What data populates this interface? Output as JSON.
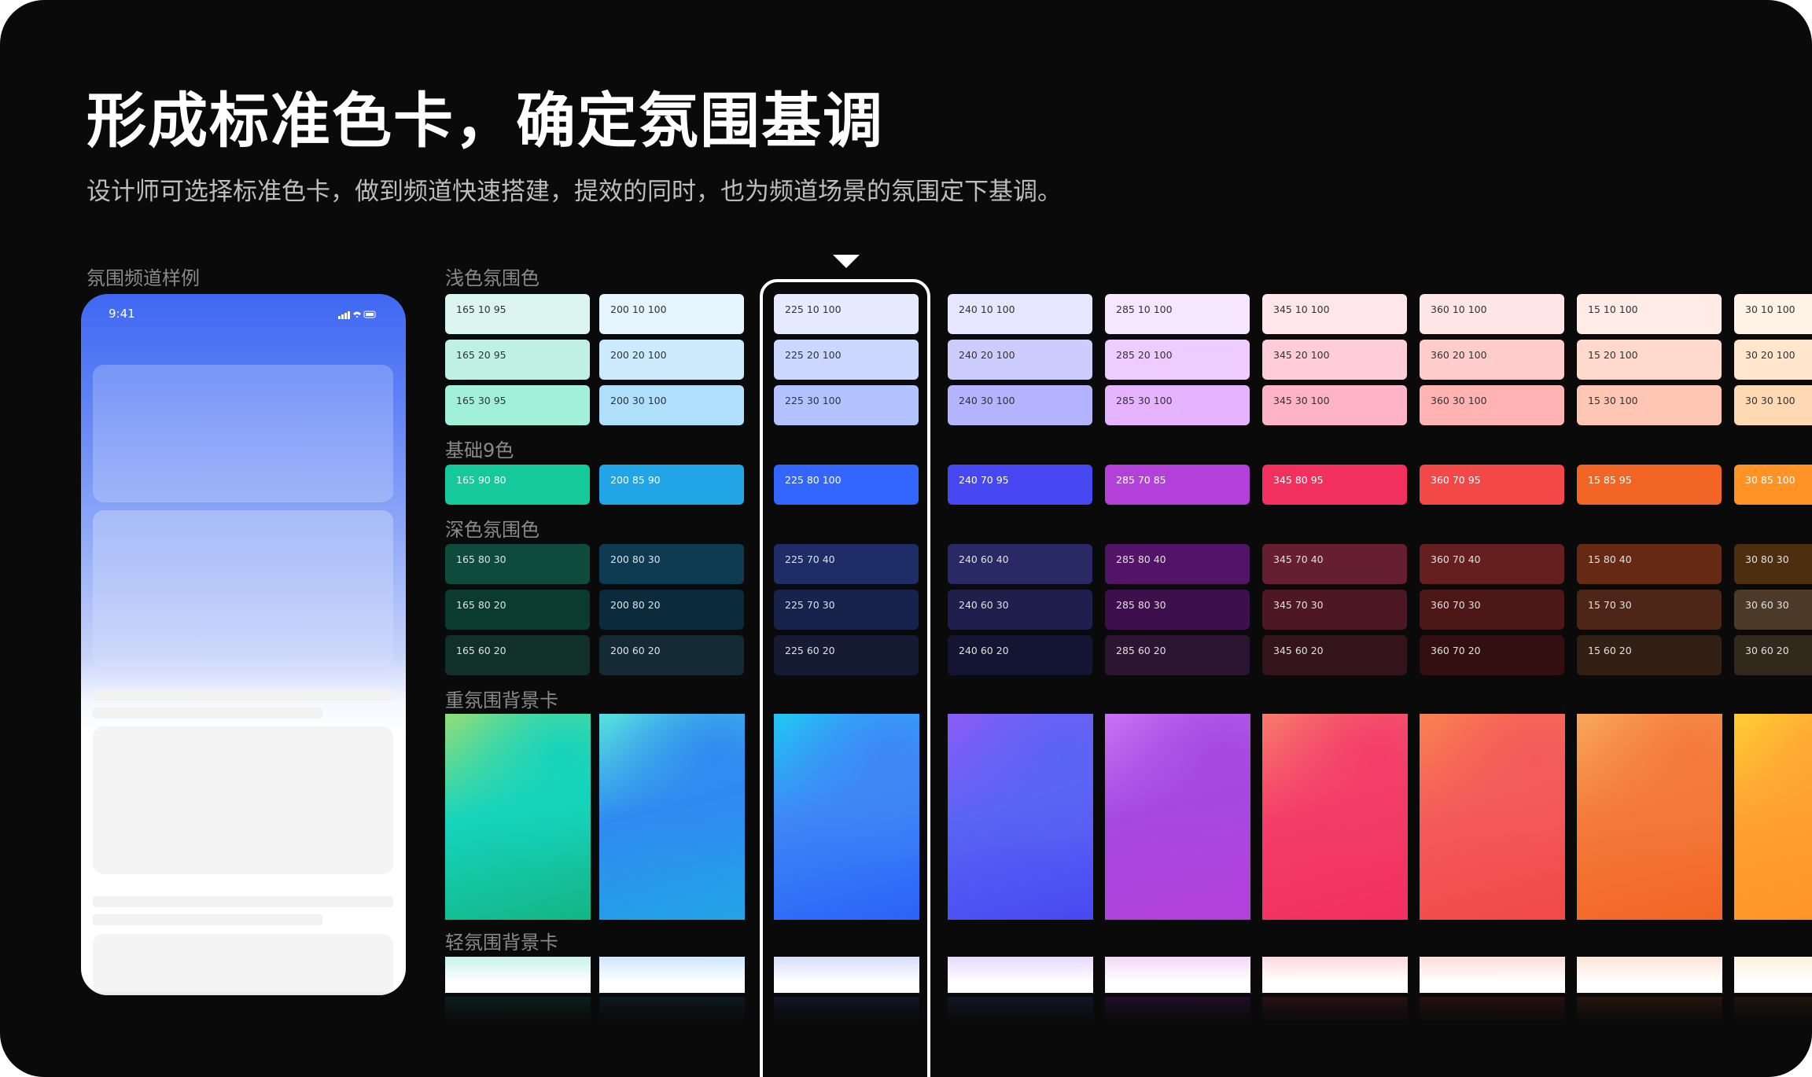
{
  "title": "形成标准色卡，确定氛围基调",
  "subtitle": "设计师可选择标准色卡，做到频道快速搭建，提效的同时，也为频道场景的氛围定下基调。",
  "sections": {
    "sample": "氛围频道样例",
    "light": "浅色氛围色",
    "base": "基础9色",
    "dark": "深色氛围色",
    "heavy_bg": "重氛围背景卡",
    "light_bg": "轻氛围背景卡"
  },
  "phone": {
    "time": "9:41"
  },
  "columns": [
    {
      "light": [
        "165 10 95",
        "165 20 95",
        "165 30 95"
      ],
      "base": "165 90 80",
      "dark": [
        "165 80 30",
        "165 80 20",
        "165 60 20"
      ],
      "light_colors": [
        "#dcf5ee",
        "#bff0e2",
        "#a3f0d9"
      ],
      "base_color": "#15c99a",
      "dark_colors": [
        "#0e4b3c",
        "#0b3a2f",
        "#12302a"
      ],
      "heavy": [
        "#8fdc7a",
        "#16d4bd",
        "#13b585"
      ],
      "tint": "#c8f2ea"
    },
    {
      "light": [
        "200 10 100",
        "200 20 100",
        "200 30 100"
      ],
      "base": "200 85 90",
      "dark": [
        "200 80 30",
        "200 80 20",
        "200 60 20"
      ],
      "light_colors": [
        "#e6f4fd",
        "#cdeafd",
        "#b0dffc"
      ],
      "base_color": "#22a5e6",
      "dark_colors": [
        "#0f3b52",
        "#0b2a3b",
        "#142a35"
      ],
      "heavy": [
        "#56e0e0",
        "#2f8af0",
        "#22a5e6"
      ],
      "tint": "#cfe6ff"
    },
    {
      "light": [
        "225 10 100",
        "225 20 100",
        "225 30 100"
      ],
      "base": "225 80 100",
      "dark": [
        "225 70 40",
        "225 70 30",
        "225 60 20"
      ],
      "light_colors": [
        "#e6ebff",
        "#ccd7ff",
        "#b3c3ff"
      ],
      "base_color": "#3366ff",
      "dark_colors": [
        "#1f2d66",
        "#17224d",
        "#141b33"
      ],
      "heavy": [
        "#22c6f4",
        "#3f86f6",
        "#2a63f8"
      ],
      "tint": "#d8dcff"
    },
    {
      "light": [
        "240 10 100",
        "240 20 100",
        "240 30 100"
      ],
      "base": "240 70 95",
      "dark": [
        "240 60 40",
        "240 60 30",
        "240 60 20"
      ],
      "light_colors": [
        "#e6e6ff",
        "#ccccff",
        "#b3b3ff"
      ],
      "base_color": "#4848f2",
      "dark_colors": [
        "#292966",
        "#1f1f4d",
        "#141433"
      ],
      "heavy": [
        "#8a5cf6",
        "#5a64f4",
        "#4848f2"
      ],
      "tint": "#e6d8ff"
    },
    {
      "light": [
        "285 10 100",
        "285 20 100",
        "285 30 100"
      ],
      "base": "285 70 85",
      "dark": [
        "285 80 40",
        "285 80 30",
        "285 60 20"
      ],
      "light_colors": [
        "#f7e6ff",
        "#efccff",
        "#e6b3ff"
      ],
      "base_color": "#b340d9",
      "dark_colors": [
        "#521466",
        "#3d0f4d",
        "#2c1433"
      ],
      "heavy": [
        "#c970f5",
        "#a648e0",
        "#b340d9"
      ],
      "tint": "#f4d8f8"
    },
    {
      "light": [
        "345 10 100",
        "345 20 100",
        "345 30 100"
      ],
      "base": "345 80 95",
      "dark": [
        "345 70 40",
        "345 70 30",
        "345 60 20"
      ],
      "light_colors": [
        "#ffe6ec",
        "#ffccd9",
        "#ffb3c6"
      ],
      "base_color": "#f2305f",
      "dark_colors": [
        "#661f30",
        "#4d1724",
        "#33141b"
      ],
      "heavy": [
        "#f77a6c",
        "#f33d69",
        "#f2305f"
      ],
      "tint": "#ffd9e0"
    },
    {
      "light": [
        "360 10 100",
        "360 20 100",
        "360 30 100"
      ],
      "base": "360 70 95",
      "dark": [
        "360 70 40",
        "360 70 30",
        "360 70 20"
      ],
      "light_colors": [
        "#ffe6e6",
        "#ffcccc",
        "#ffb3b3"
      ],
      "base_color": "#f24848",
      "dark_colors": [
        "#661f1f",
        "#4d1717",
        "#330f0f"
      ],
      "heavy": [
        "#fa8150",
        "#f45a5a",
        "#f24848"
      ],
      "tint": "#ffdcd8"
    },
    {
      "light": [
        "15 10 100",
        "15 20 100",
        "15 30 100"
      ],
      "base": "15 85 95",
      "dark": [
        "15 80 40",
        "15 70 30",
        "15 60 20"
      ],
      "light_colors": [
        "#ffece6",
        "#ffd9cc",
        "#ffc6b3"
      ],
      "base_color": "#f26524",
      "dark_colors": [
        "#662a14",
        "#4d2617",
        "#332014"
      ],
      "heavy": [
        "#f9a65a",
        "#f47a3a",
        "#f26524"
      ],
      "tint": "#ffe4d6"
    },
    {
      "light": [
        "30 10 100",
        "30 20 100",
        "30 30 100"
      ],
      "base": "30 85 100",
      "dark": [
        "30 80 30",
        "30 60 30",
        "30 60 20"
      ],
      "light_colors": [
        "#fff2e6",
        "#ffe6cc",
        "#ffd9b3"
      ],
      "base_color": "#ff9326",
      "dark_colors": [
        "#4d2e0f",
        "#4d3b2a",
        "#33281c"
      ],
      "heavy": [
        "#ffcc33",
        "#ffa033",
        "#ff9326"
      ],
      "tint": "#fff0dc"
    }
  ]
}
